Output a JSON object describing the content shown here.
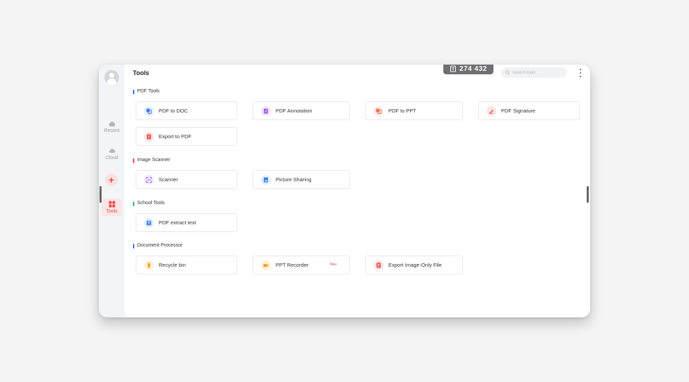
{
  "header": {
    "title": "Tools"
  },
  "counter": {
    "value": "274 432"
  },
  "search": {
    "placeholder": "Search tools"
  },
  "sidebar": {
    "items": [
      {
        "label": "Recent"
      },
      {
        "label": "Cloud"
      },
      {
        "label": "+"
      },
      {
        "label": "Tools"
      }
    ]
  },
  "sections": [
    {
      "title": "PDF Tools",
      "accent": "#3c7cf0",
      "tools": [
        {
          "label": "PDF to DOC",
          "icon": "pdf-to-doc-icon",
          "color": "#3c7cf0",
          "bg": "#e5eefd"
        },
        {
          "label": "PDF Annotation",
          "icon": "pdf-annotation-icon",
          "color": "#a05de6",
          "bg": "#f0e5fb"
        },
        {
          "label": "PDF to PPT",
          "icon": "pdf-to-ppt-icon",
          "color": "#ef6a4a",
          "bg": "#fde8e2"
        },
        {
          "label": "PDF Signature",
          "icon": "pdf-signature-icon",
          "color": "#e84d4d",
          "bg": "#fde4e4"
        },
        {
          "label": "Export to PDF",
          "icon": "export-to-pdf-icon",
          "color": "#e84d4d",
          "bg": "#fde4e4"
        }
      ]
    },
    {
      "title": "Image Scanner",
      "accent": "#e84d4d",
      "tools": [
        {
          "label": "Scanner",
          "icon": "scanner-icon",
          "color": "#a05de6",
          "bg": "#f0e5fb"
        },
        {
          "label": "Picture Sharing",
          "icon": "picture-sharing-icon",
          "color": "#3c7cf0",
          "bg": "#e5eefd"
        }
      ]
    },
    {
      "title": "School Tools",
      "accent": "#2bb673",
      "tools": [
        {
          "label": "PDF extract text",
          "icon": "pdf-extract-text-icon",
          "color": "#3c7cf0",
          "bg": "#e5eefd"
        }
      ]
    },
    {
      "title": "Document Processor",
      "accent": "#3c7cf0",
      "tools": [
        {
          "label": "Recycle bin",
          "icon": "recycle-bin-icon",
          "color": "#f5a623",
          "bg": "#fdf1dc"
        },
        {
          "label": "PPT Recorder",
          "icon": "ppt-recorder-icon",
          "color": "#f5a623",
          "bg": "#fdf1dc",
          "badge": "New"
        },
        {
          "label": "Export Image-Only File",
          "icon": "export-image-only-file-icon",
          "color": "#e84d4d",
          "bg": "#fde4e4"
        }
      ]
    }
  ]
}
